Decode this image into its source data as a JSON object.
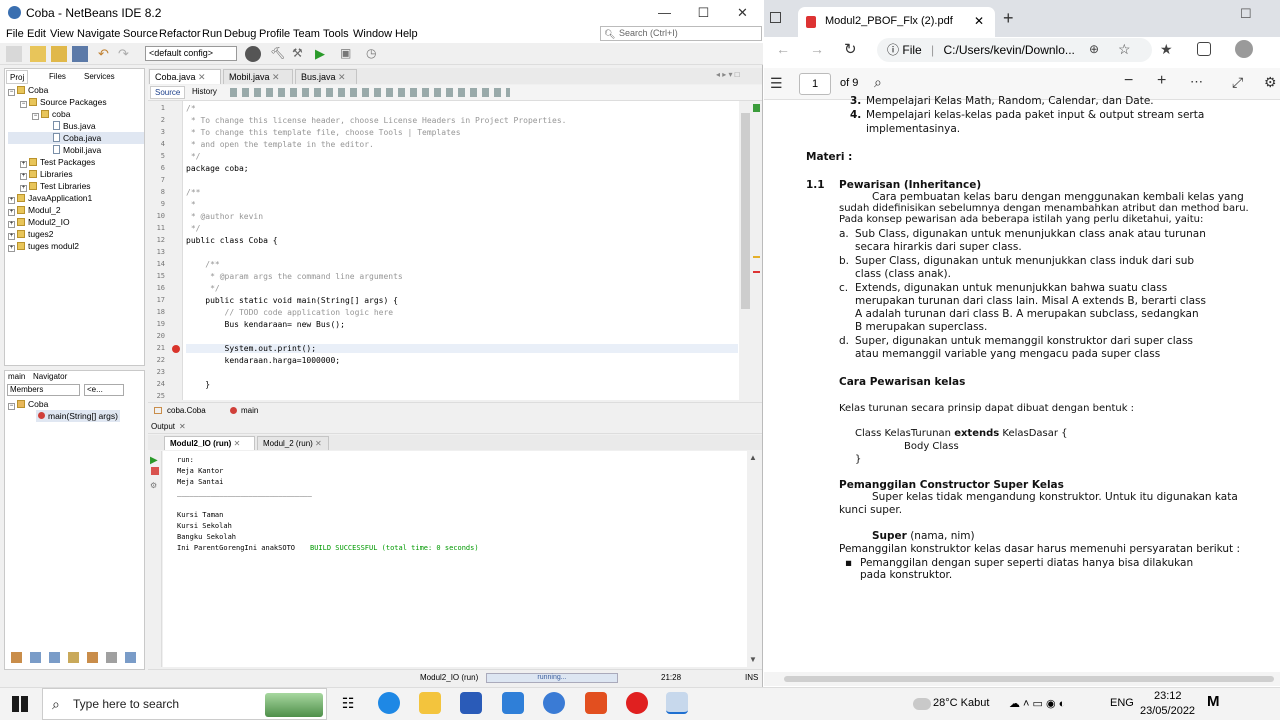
{
  "netbeans": {
    "title": "Coba - NetBeans IDE 8.2",
    "menu": [
      "File",
      "Edit",
      "View",
      "Navigate",
      "Source",
      "Refactor",
      "Run",
      "Debug",
      "Profile",
      "Team",
      "Tools",
      "Window",
      "Help"
    ],
    "search_placeholder": "Search (Ctrl+I)",
    "config": "<default config>",
    "panel_tabs": [
      "Proj",
      "Files",
      "Services"
    ],
    "tree": [
      {
        "label": "Coba",
        "indent": 0,
        "kind": "proj"
      },
      {
        "label": "Source Packages",
        "indent": 1,
        "kind": "folder"
      },
      {
        "label": "coba",
        "indent": 2,
        "kind": "folder"
      },
      {
        "label": "Bus.java",
        "indent": 3,
        "kind": "file"
      },
      {
        "label": "Coba.java",
        "indent": 3,
        "kind": "file"
      },
      {
        "label": "Mobil.java",
        "indent": 3,
        "kind": "file"
      },
      {
        "label": "Test Packages",
        "indent": 1,
        "kind": "folder"
      },
      {
        "label": "Libraries",
        "indent": 1,
        "kind": "folder"
      },
      {
        "label": "Test Libraries",
        "indent": 1,
        "kind": "folder"
      },
      {
        "label": "JavaApplication1",
        "indent": 0,
        "kind": "proj"
      },
      {
        "label": "Modul_2",
        "indent": 0,
        "kind": "proj"
      },
      {
        "label": "Modul2_IO",
        "indent": 0,
        "kind": "proj"
      },
      {
        "label": "tuges2",
        "indent": 0,
        "kind": "proj"
      },
      {
        "label": "tuges modul2",
        "indent": 0,
        "kind": "proj"
      }
    ],
    "navigator": {
      "tabs": [
        "main",
        "Navigator"
      ],
      "filter": "Members",
      "filter2": "<e...",
      "root": "Coba",
      "item": "main(String[] args)"
    },
    "editor_tabs": [
      "Coba.java",
      "Mobil.java",
      "Bus.java"
    ],
    "editor_modes": [
      "Source",
      "History"
    ],
    "code_lines": [
      {
        "n": "1",
        "t": "/*",
        "c": "cm"
      },
      {
        "n": "2",
        "t": " * To change this license header, choose License Headers in Project Properties.",
        "c": "cm"
      },
      {
        "n": "3",
        "t": " * To change this template file, choose Tools | Templates",
        "c": "cm"
      },
      {
        "n": "4",
        "t": " * and open the template in the editor.",
        "c": "cm"
      },
      {
        "n": "5",
        "t": " */",
        "c": "cm"
      },
      {
        "n": "6",
        "t": "package coba;",
        "c": ""
      },
      {
        "n": "7",
        "t": "",
        "c": ""
      },
      {
        "n": "8",
        "t": "/**",
        "c": "cm"
      },
      {
        "n": "9",
        "t": " *",
        "c": "cm"
      },
      {
        "n": "10",
        "t": " * @author kevin",
        "c": "cm"
      },
      {
        "n": "11",
        "t": " */",
        "c": "cm"
      },
      {
        "n": "12",
        "t": "public class Coba {",
        "c": ""
      },
      {
        "n": "13",
        "t": "",
        "c": ""
      },
      {
        "n": "14",
        "t": "    /**",
        "c": "cm"
      },
      {
        "n": "15",
        "t": "     * @param args the command line arguments",
        "c": "cm"
      },
      {
        "n": "16",
        "t": "     */",
        "c": "cm"
      },
      {
        "n": "17",
        "t": "    public static void main(String[] args) {",
        "c": ""
      },
      {
        "n": "18",
        "t": "        // TODO code application logic here",
        "c": "cm"
      },
      {
        "n": "19",
        "t": "        Bus kendaraan= new Bus();",
        "c": ""
      },
      {
        "n": "20",
        "t": "",
        "c": ""
      },
      {
        "n": "21",
        "t": "        System.out.print();",
        "c": "hl"
      },
      {
        "n": "22",
        "t": "        kendaraan.harga=1000000;",
        "c": ""
      },
      {
        "n": "23",
        "t": "",
        "c": ""
      },
      {
        "n": "24",
        "t": "    }",
        "c": ""
      },
      {
        "n": "25",
        "t": "",
        "c": ""
      }
    ],
    "breadcrumb": [
      "coba.Coba",
      "main"
    ],
    "output_label": "Output",
    "output_tabs": [
      "Modul2_IO (run)",
      "Modul_2 (run)"
    ],
    "output_lines": [
      "run:",
      "Meja Kantor",
      "Meja Santai",
      "________________________________",
      "",
      "Kursi Taman",
      "Kursi Sekolah",
      "Bangku Sekolah",
      "Ini ParentGorengIni anakSOTO"
    ],
    "build_msg": "BUILD SUCCESSFUL (total time: 0 seconds)",
    "status": {
      "task": "Modul2_IO (run)",
      "progress": "running...",
      "pos": "21:28",
      "mode": "INS"
    }
  },
  "browser": {
    "tab_title": "Modul2_PBOF_Flx (2).pdf",
    "url_prefix": "File",
    "url": "C:/Users/kevin/Downlo...",
    "page": "1",
    "page_total": "of 9",
    "pdf": {
      "top_items": [
        {
          "num": "3.",
          "text": "Mempelajari Kelas Math, Random, Calendar, dan Date."
        },
        {
          "num": "4.",
          "text": "Mempelajari kelas-kelas pada paket input & output stream serta"
        },
        {
          "num": "",
          "text": "implementasinya."
        }
      ],
      "materi": "Materi :",
      "section_num": "1.1",
      "section_title": "Pewarisan (Inheritance)",
      "intro": [
        "Cara  pembuatan  kelas  baru  dengan  menggunakan  kembali  kelas  yang",
        "sudah didefinisikan sebelumnya dengan menambahkan atribut dan method baru.",
        "Pada konsep pewarisan ada beberapa istilah yang perlu diketahui, yaitu:"
      ],
      "terms": [
        {
          "k": "a.",
          "l1": "Sub Class, digunakan untuk menunjukkan class anak atau turunan",
          "l2": "secara hirarkis dari super class."
        },
        {
          "k": "b.",
          "l1": "Super Class, digunakan untuk menunjukkan class induk dari sub",
          "l2": "class (class anak)."
        },
        {
          "k": "c.",
          "l1": "Extends,   digunakan   untuk   menunjukkan   bahwa   suatu   class",
          "l2": "merupakan turunan dari class lain. Misal A extends B, berarti class",
          "l3": "A adalah turunan dari class B. A merupakan subclass, sedangkan",
          "l4": "B merupakan superclass."
        },
        {
          "k": "d.",
          "l1": "Super, digunakan untuk memanggil konstruktor dari super class",
          "l2": "atau memanggil variable yang mengacu pada super class"
        }
      ],
      "cara_title": "Cara Pewarisan kelas",
      "cara_text": "Kelas turunan secara prinsip dapat dibuat dengan bentuk :",
      "code1_a": "Class KelasTurunan ",
      "code1_kw": "extends",
      "code1_b": " KelasDasar {",
      "code2": "Body Class",
      "code3": "}",
      "pem_title": "Pemanggilan Constructor Super Kelas",
      "pem_text1": "Super kelas tidak mengandung konstruktor. Untuk itu digunakan kata",
      "pem_text2": "kunci super.",
      "super_kw": "Super",
      "super_args": " (nama, nim)",
      "req_text": "Pemanggilan konstruktor kelas dasar harus memenuhi persyaratan berikut :",
      "bullet1": "Pemanggilan dengan super seperti diatas hanya bisa dilakukan",
      "bullet2": "pada konstruktor."
    }
  },
  "taskbar": {
    "search": "Type here to search",
    "weather": "28°C  Kabut",
    "lang": "ENG",
    "time": "23:12",
    "date": "23/05/2022"
  },
  "colors": {
    "keyword": "#0000e6",
    "comment": "#969696",
    "field": "#009900",
    "edge_blue": "#0078d4"
  }
}
